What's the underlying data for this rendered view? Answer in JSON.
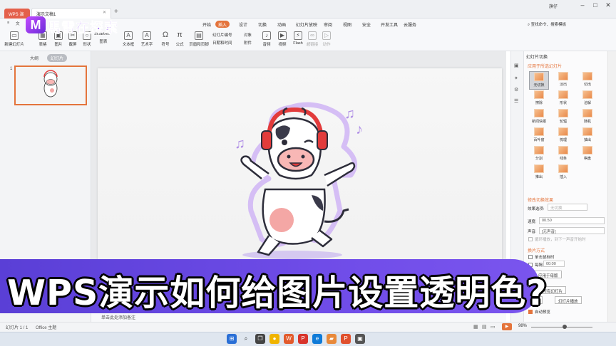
{
  "titlebar": {
    "home_tab": "WPS 演示",
    "doc_tab": "演示文稿1",
    "doc_close": "✕",
    "new_tab": "+",
    "user": "旗仔"
  },
  "watermark": {
    "logo_letter": "M",
    "text": "馬雷在探索"
  },
  "ribbon": {
    "tabs": [
      "开始",
      "插入",
      "设计",
      "切换",
      "动画",
      "幻灯片放映",
      "审阅",
      "视图",
      "安全",
      "开发工具",
      "云服务"
    ],
    "active_tab": "插入",
    "search": "查找命令、搜索模板",
    "file_menu": "文",
    "tools": [
      {
        "label": "新建幻灯片",
        "icon": "new-slide-icon"
      },
      {
        "label": "表格",
        "icon": "table-icon"
      },
      {
        "label": "图片",
        "icon": "picture-icon"
      },
      {
        "label": "截屏",
        "icon": "screenshot-icon"
      },
      {
        "label": "形状",
        "icon": "shape-icon"
      },
      {
        "label": "图表",
        "icon": "chart-icon"
      },
      {
        "label": "文本框",
        "icon": "textbox-icon"
      },
      {
        "label": "艺术字",
        "icon": "wordart-icon"
      },
      {
        "label": "符号",
        "icon": "symbol-icon"
      },
      {
        "label": "公式",
        "icon": "formula-icon"
      },
      {
        "label": "页眉和页脚",
        "icon": "header-footer-icon"
      }
    ],
    "small_tools": [
      "SmartArt",
      "幻灯片编号",
      "对象",
      "日期和时间",
      "附件"
    ],
    "media_tools": [
      "音频",
      "视频",
      "Flash",
      "超链接",
      "动作"
    ],
    "symbol_glyph": "Ω",
    "formula_glyph": "π"
  },
  "left_panel": {
    "tab_outline": "大纲",
    "tab_slides": "幻灯片",
    "slide_number": "1"
  },
  "notes": {
    "placeholder": "单击此处添加备注"
  },
  "right_panel": {
    "title": "幻灯片切换",
    "apply_label": "应用于所选幻灯片",
    "transitions": [
      "无切换",
      "淡出",
      "切出",
      "擦除",
      "形状",
      "溶解",
      "新闻快报",
      "轮辐",
      "随机",
      "百叶窗",
      "梳理",
      "抽出",
      "分割",
      "线条",
      "棋盘",
      "推出",
      "插入"
    ],
    "selected_transition": "无切换",
    "modify_heading": "修改切换效果",
    "effect_label": "效果选项:",
    "effect_value": "无切换",
    "speed_label": "速度:",
    "speed_value": "00.50",
    "sound_label": "声音:",
    "sound_value": "[无声音]",
    "loop_label": "循环播放，到下一声音开始时",
    "advance_heading": "换片方式",
    "on_click_label": "单击鼠标时",
    "every_label": "每隔",
    "every_value": "00:00",
    "apply_master_btn": "应用于母版",
    "apply_all_btn": "应用于所有幻灯片",
    "play_btn": "播放",
    "slideshow_btn": "幻灯片播放",
    "auto_preview_label": "自动预览"
  },
  "statusbar": {
    "slide": "幻灯片 1 / 1",
    "theme": "Office 主题",
    "zoom": "98%",
    "zoom_level": 0.55
  },
  "caption": "WPS演示如何给图片设置透明色?",
  "colors": {
    "accent": "#e4743c",
    "caption_bg": "#6a48e2",
    "logo": "#7b2ff0"
  }
}
